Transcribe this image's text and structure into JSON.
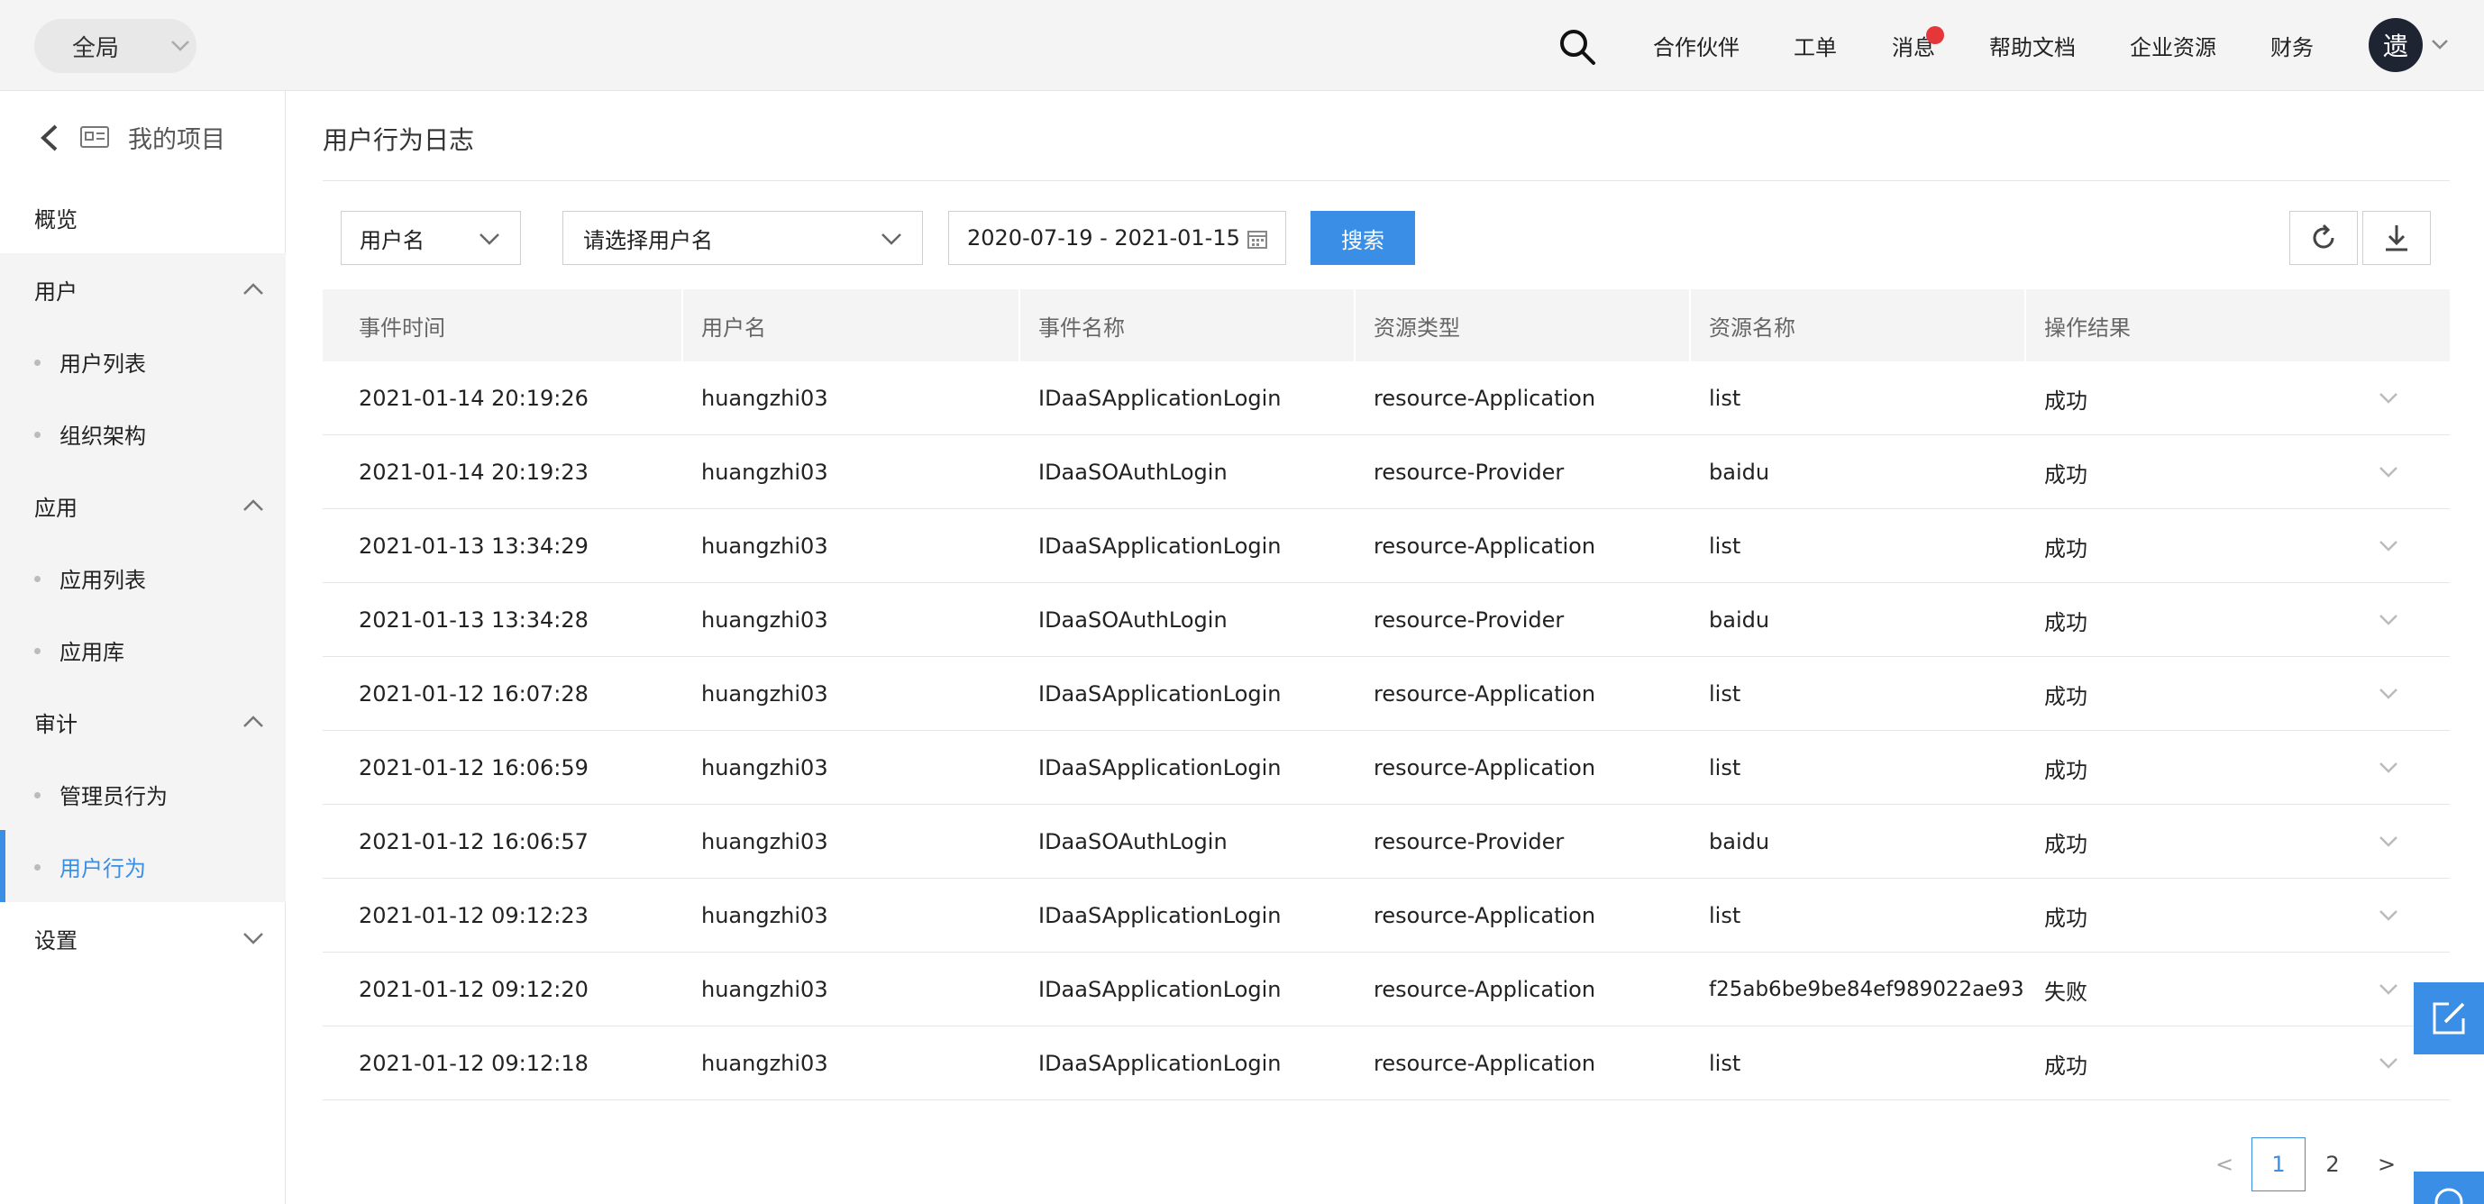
{
  "topbar": {
    "scope_label": "全局",
    "nav": [
      "合作伙伴",
      "工单",
      "消息",
      "帮助文档",
      "企业资源",
      "财务"
    ],
    "avatar_text": "遗"
  },
  "sidebar": {
    "project_label": "我的项目",
    "items": {
      "overview": "概览",
      "user_group": "用户",
      "user_list": "用户列表",
      "org": "组织架构",
      "app_group": "应用",
      "app_list": "应用列表",
      "app_lib": "应用库",
      "audit_group": "审计",
      "admin_action": "管理员行为",
      "user_action": "用户行为",
      "settings_group": "设置"
    }
  },
  "page": {
    "title": "用户行为日志"
  },
  "filters": {
    "field_select": "用户名",
    "user_select_placeholder": "请选择用户名",
    "date_range": "2020-07-19 - 2021-01-15",
    "search_label": "搜索"
  },
  "table": {
    "columns": [
      "事件时间",
      "用户名",
      "事件名称",
      "资源类型",
      "资源名称",
      "操作结果"
    ],
    "rows": [
      [
        "2021-01-14 20:19:26",
        "huangzhi03",
        "IDaaSApplicationLogin",
        "resource-Application",
        "list",
        "成功"
      ],
      [
        "2021-01-14 20:19:23",
        "huangzhi03",
        "IDaaSOAuthLogin",
        "resource-Provider",
        "baidu",
        "成功"
      ],
      [
        "2021-01-13 13:34:29",
        "huangzhi03",
        "IDaaSApplicationLogin",
        "resource-Application",
        "list",
        "成功"
      ],
      [
        "2021-01-13 13:34:28",
        "huangzhi03",
        "IDaaSOAuthLogin",
        "resource-Provider",
        "baidu",
        "成功"
      ],
      [
        "2021-01-12 16:07:28",
        "huangzhi03",
        "IDaaSApplicationLogin",
        "resource-Application",
        "list",
        "成功"
      ],
      [
        "2021-01-12 16:06:59",
        "huangzhi03",
        "IDaaSApplicationLogin",
        "resource-Application",
        "list",
        "成功"
      ],
      [
        "2021-01-12 16:06:57",
        "huangzhi03",
        "IDaaSOAuthLogin",
        "resource-Provider",
        "baidu",
        "成功"
      ],
      [
        "2021-01-12 09:12:23",
        "huangzhi03",
        "IDaaSApplicationLogin",
        "resource-Application",
        "list",
        "成功"
      ],
      [
        "2021-01-12 09:12:20",
        "huangzhi03",
        "IDaaSApplicationLogin",
        "resource-Application",
        "f25ab6be9be84ef989022ae93",
        "失败"
      ],
      [
        "2021-01-12 09:12:18",
        "huangzhi03",
        "IDaaSApplicationLogin",
        "resource-Application",
        "list",
        "成功"
      ]
    ]
  },
  "pagination": {
    "prev": "<",
    "pages": [
      "1",
      "2"
    ],
    "next": ">",
    "current": "1"
  },
  "colors": {
    "accent": "#3a8ee6",
    "badge": "#e5363a"
  },
  "icons": [
    "search-icon",
    "chevron-down-icon",
    "back-arrow-icon",
    "project-card-icon",
    "chevron-up-icon",
    "calendar-icon",
    "refresh-icon",
    "download-icon",
    "edit-icon"
  ]
}
